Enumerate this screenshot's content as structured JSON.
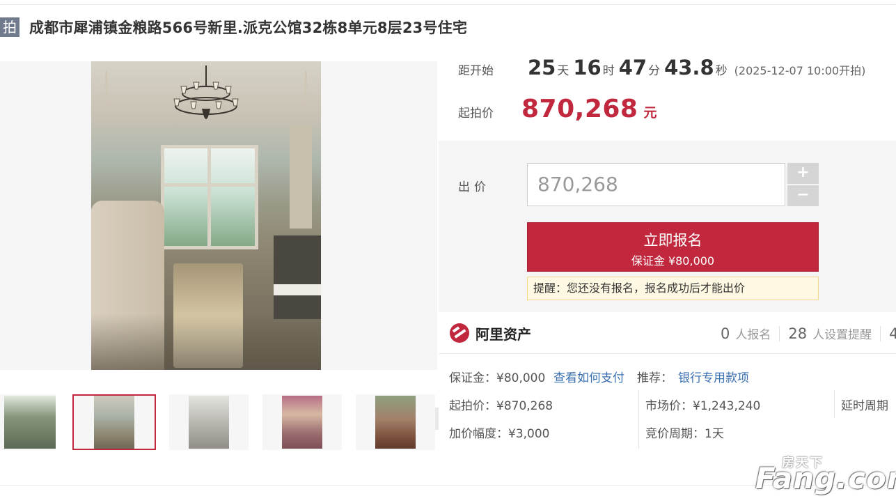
{
  "listing": {
    "tag": "拍",
    "title": "成都市犀浦镇金粮路566号新里.派克公馆32栋8单元8层23号住宅"
  },
  "countdown": {
    "label": "距开始",
    "days": "25",
    "days_unit": "天",
    "hours": "16",
    "hours_unit": "时",
    "minutes": "47",
    "minutes_unit": "分",
    "seconds": "43.8",
    "seconds_unit": "秒",
    "start_time": "(2025-12-07 10:00开拍)"
  },
  "start_price": {
    "label": "起拍价",
    "value": "870,268",
    "unit": "元"
  },
  "bid": {
    "label": "出价",
    "input_value": "870,268",
    "plus": "+",
    "minus": "−",
    "register_label": "立即报名",
    "deposit_label": "保证金 ¥80,000",
    "reminder": "提醒：您还没有报名，报名成功后才能出价"
  },
  "platform": {
    "name": "阿里资产",
    "registered_count": "0",
    "registered_text": "人报名",
    "reminder_count": "28",
    "reminder_text": "人设置提醒",
    "third_count": "4"
  },
  "details": {
    "deposit": "保证金：¥80,000",
    "how_to_pay": "查看如何支付",
    "recommend_label": "推荐：",
    "recommend_link": "银行专用款项",
    "start_price": "起拍价：¥870,268",
    "market_price": "市场价：¥1,243,240",
    "delay_period": "延时周期",
    "increment": "加价幅度：¥3,000",
    "bidding_period": "竞价周期：1天"
  },
  "gallery": {
    "thumb_count": 5,
    "selected_index": 1
  },
  "watermark": {
    "top": "房天下",
    "main": "Fang.com"
  },
  "colors": {
    "accent": "#c1283d",
    "link": "#3a6fb0",
    "reminder_bg": "#fff9e3"
  },
  "icons": {
    "zoom": "magnifier-icon",
    "platform": "ali-assets-logo-icon"
  }
}
